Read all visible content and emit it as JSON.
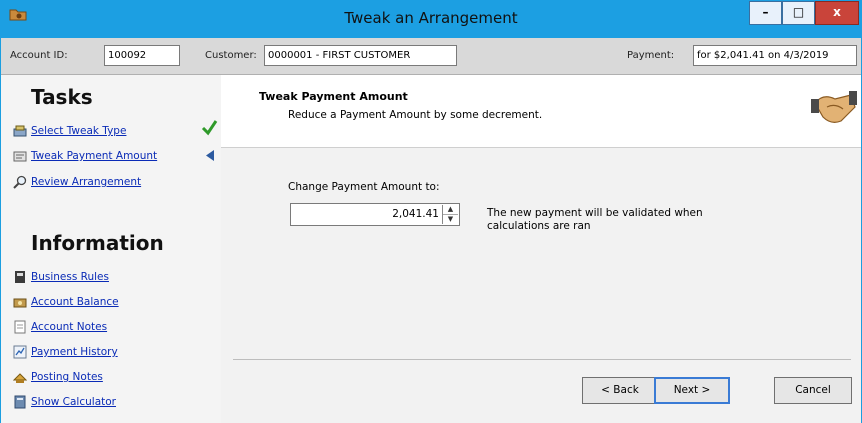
{
  "window": {
    "title": "Tweak an Arrangement",
    "controls": {
      "minimize": "–",
      "maximize": "□",
      "close": "x"
    }
  },
  "infobar": {
    "account_label": "Account ID:",
    "account_value": "100092",
    "customer_label": "Customer:",
    "customer_value": "0000001 - FIRST CUSTOMER",
    "payment_label": "Payment:",
    "payment_value": "for $2,041.41 on 4/3/2019"
  },
  "tasks": {
    "title": "Tasks",
    "items": [
      {
        "label": "Select Tweak Type",
        "icon": "wand-icon",
        "status": "checkmark-icon"
      },
      {
        "label": "Tweak Payment Amount",
        "icon": "edit-icon",
        "status": "current-step-arrow-icon"
      },
      {
        "label": "Review Arrangement",
        "icon": "magnifier-icon"
      }
    ]
  },
  "information": {
    "title": "Information",
    "items": [
      {
        "label": "Business Rules",
        "icon": "rules-book-icon"
      },
      {
        "label": "Account Balance",
        "icon": "balance-icon"
      },
      {
        "label": "Account Notes",
        "icon": "notes-icon"
      },
      {
        "label": "Payment History",
        "icon": "history-icon"
      },
      {
        "label": "Posting Notes",
        "icon": "posting-icon"
      },
      {
        "label": "Show Calculator",
        "icon": "calculator-icon"
      }
    ]
  },
  "step": {
    "title": "Tweak Payment Amount",
    "description": "Reduce a Payment Amount by some decrement.",
    "icon": "handshake-icon"
  },
  "form": {
    "label": "Change Payment Amount to:",
    "value": "2,041.41",
    "hint": "The new payment will be validated when calculations are ran"
  },
  "buttons": {
    "back": "< Back",
    "next": "Next >",
    "cancel": "Cancel"
  }
}
